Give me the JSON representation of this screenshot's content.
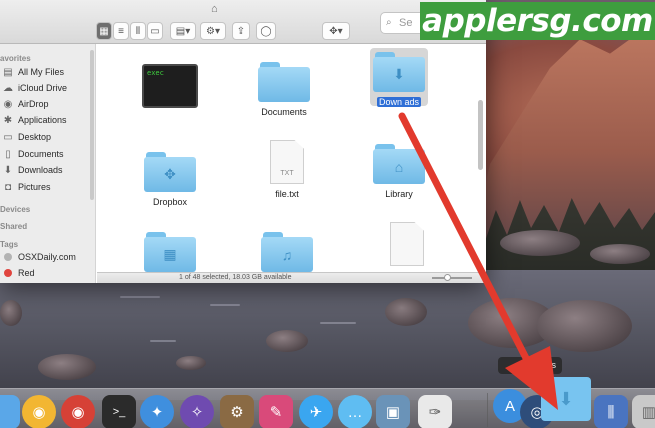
{
  "watermark": {
    "text": "applersg.com"
  },
  "toolbar": {
    "search_placeholder": "Se",
    "icons": [
      "icon-view-button",
      "list-view-button",
      "column-view-button",
      "coverflow-view-button",
      "arrange-menu",
      "action-menu",
      "share-button",
      "tags-button",
      "dropbox-menu"
    ]
  },
  "sidebar": {
    "favorites_heading": "avorites",
    "items": [
      {
        "label": "All My Files",
        "icon": "all-files-icon"
      },
      {
        "label": "iCloud Drive",
        "icon": "cloud-icon"
      },
      {
        "label": "AirDrop",
        "icon": "airdrop-icon"
      },
      {
        "label": "Applications",
        "icon": "applications-icon"
      },
      {
        "label": "Desktop",
        "icon": "desktop-icon"
      },
      {
        "label": "Documents",
        "icon": "documents-icon"
      },
      {
        "label": "Downloads",
        "icon": "downloads-icon"
      },
      {
        "label": "Pictures",
        "icon": "pictures-icon"
      }
    ],
    "devices_heading": "Devices",
    "shared_heading": "Shared",
    "tags_heading": "Tags",
    "tags": [
      {
        "label": "OSXDaily.com",
        "color": "#b3b3b3"
      },
      {
        "label": "Red",
        "color": "#e0443e"
      }
    ]
  },
  "files": [
    {
      "name": "",
      "kind": "terminal",
      "screen_text": "exec"
    },
    {
      "name": "Documents",
      "kind": "folder"
    },
    {
      "name": "Downloads",
      "kind": "folder",
      "selected": true,
      "display": "Down   ads"
    },
    {
      "name": "Dropbox",
      "kind": "folder"
    },
    {
      "name": "file.txt",
      "kind": "document",
      "badge": "TXT"
    },
    {
      "name": "Library",
      "kind": "folder"
    }
  ],
  "statusbar": {
    "text": "1 of 48 selected, 18.03 GB available"
  },
  "dock": {
    "tooltip": "ads",
    "apps": [
      {
        "name": "finder",
        "color": "#5aa7e8"
      },
      {
        "name": "chrome",
        "color": "#f2b632"
      },
      {
        "name": "chrome-alt",
        "color": "#d64136"
      },
      {
        "name": "terminal",
        "color": "#2b2b2b"
      },
      {
        "name": "safari",
        "color": "#3f8fde"
      },
      {
        "name": "instruments",
        "color": "#6f4bb0"
      },
      {
        "name": "automator",
        "color": "#8a6a44"
      },
      {
        "name": "skitch",
        "color": "#d94a7a"
      },
      {
        "name": "twitter",
        "color": "#3aa6f0"
      },
      {
        "name": "messages",
        "color": "#5fbdf2"
      },
      {
        "name": "preview",
        "color": "#6a93b8"
      },
      {
        "name": "textedit",
        "color": "#e9e9e9"
      },
      {
        "name": "app-store",
        "color": "#3b8ede"
      },
      {
        "name": "quicktime",
        "color": "#2e4d7a"
      },
      {
        "name": "downloads-stack",
        "color": "#78c4f0"
      },
      {
        "name": "applications-stack",
        "color": "#4a74c0"
      },
      {
        "name": "trash",
        "color": "#c9c9c9"
      }
    ]
  },
  "accent": "#e23a2d"
}
